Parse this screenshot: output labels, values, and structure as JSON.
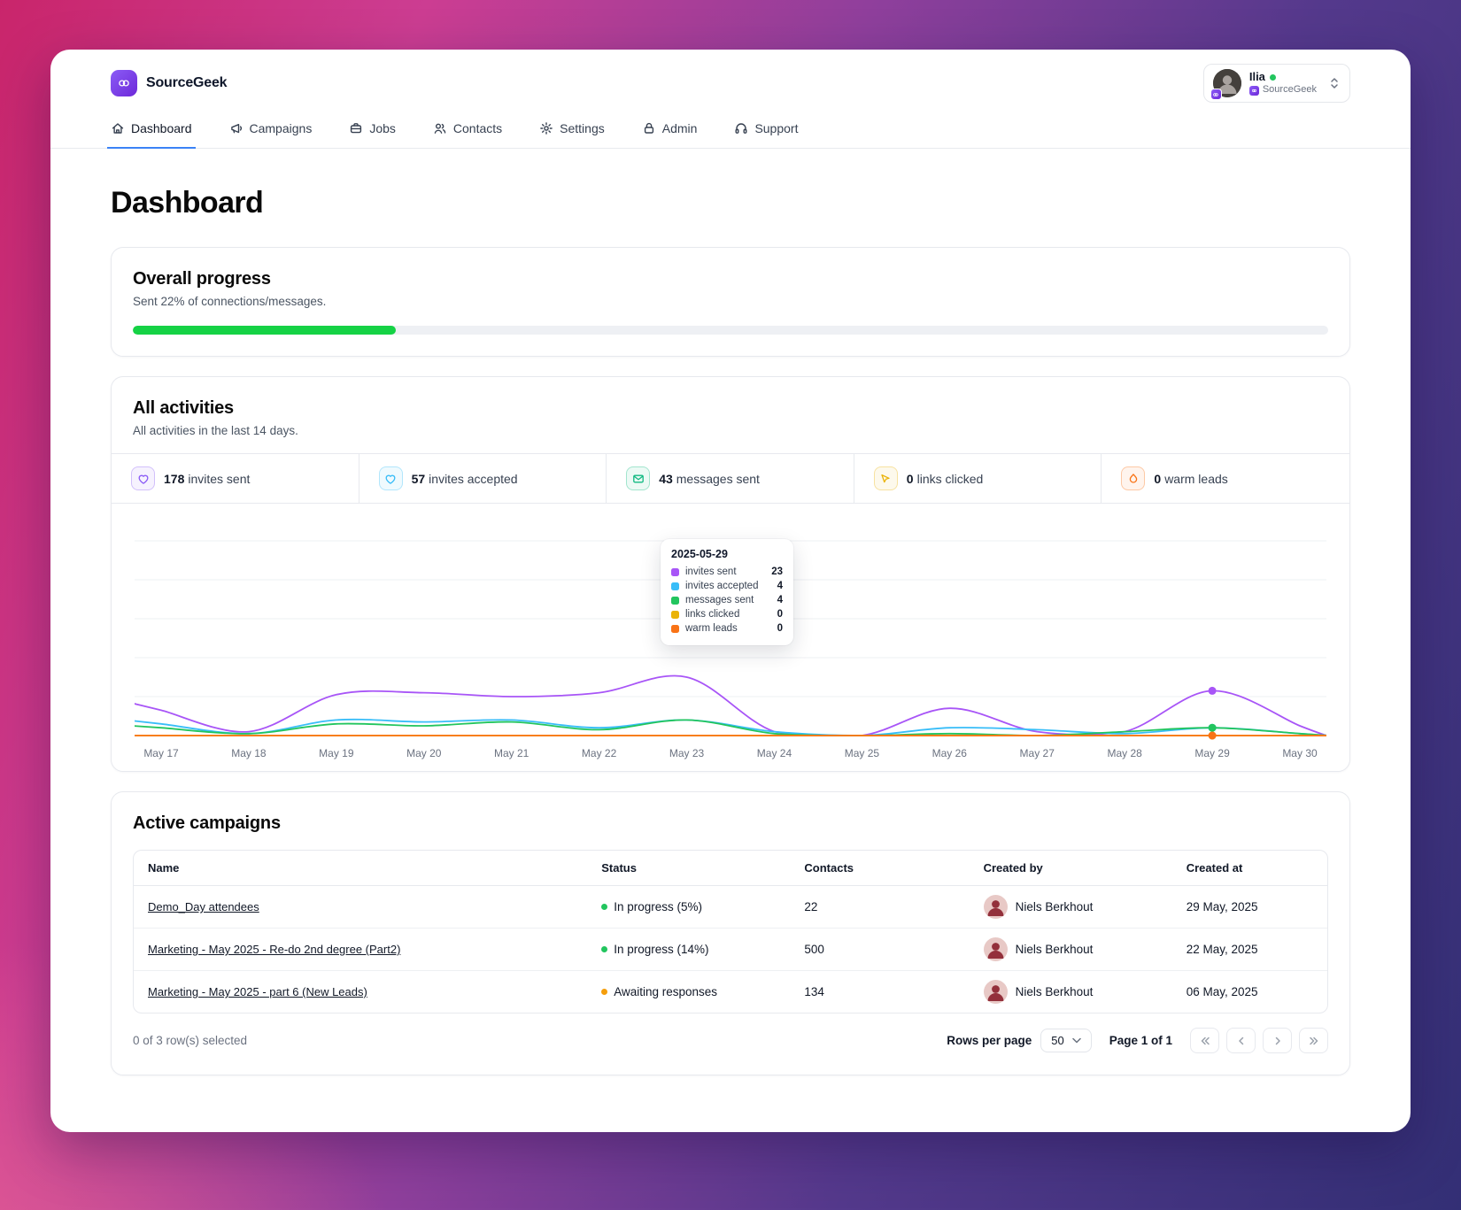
{
  "app": {
    "name": "SourceGeek"
  },
  "user": {
    "name": "Ilia",
    "org": "SourceGeek"
  },
  "nav": [
    {
      "label": "Dashboard",
      "icon": "home",
      "active": true
    },
    {
      "label": "Campaigns",
      "icon": "megaphone",
      "active": false
    },
    {
      "label": "Jobs",
      "icon": "briefcase",
      "active": false
    },
    {
      "label": "Contacts",
      "icon": "users",
      "active": false
    },
    {
      "label": "Settings",
      "icon": "gear",
      "active": false
    },
    {
      "label": "Admin",
      "icon": "lock",
      "active": false
    },
    {
      "label": "Support",
      "icon": "headset",
      "active": false
    }
  ],
  "page_title": "Dashboard",
  "overall_progress": {
    "title": "Overall progress",
    "subtitle": "Sent 22% of connections/messages.",
    "percent": 22,
    "bar_color": "#15d245"
  },
  "activities": {
    "title": "All activities",
    "subtitle": "All activities in the last 14 days.",
    "stats": [
      {
        "value": "178",
        "label": "invites sent",
        "icon": "heart",
        "color": "#8b5cf6"
      },
      {
        "value": "57",
        "label": "invites accepted",
        "icon": "heart",
        "color": "#38bdf8"
      },
      {
        "value": "43",
        "label": "messages sent",
        "icon": "mail",
        "color": "#10b981"
      },
      {
        "value": "0",
        "label": "links clicked",
        "icon": "cursor",
        "color": "#eab308"
      },
      {
        "value": "0",
        "label": "warm leads",
        "icon": "flame",
        "color": "#f97316"
      }
    ]
  },
  "chart_data": {
    "type": "line",
    "x": [
      "May 17",
      "May 18",
      "May 19",
      "May 20",
      "May 21",
      "May 22",
      "May 23",
      "May 24",
      "May 25",
      "May 26",
      "May 27",
      "May 28",
      "May 29",
      "May 30"
    ],
    "series": [
      {
        "name": "invites sent",
        "color": "#a855f7",
        "values": [
          13,
          2,
          21,
          22,
          20,
          22,
          30,
          2,
          0,
          14,
          2,
          2,
          23,
          5
        ]
      },
      {
        "name": "invites accepted",
        "color": "#38bdf8",
        "values": [
          6,
          1,
          8,
          7,
          8,
          4,
          8,
          2,
          0,
          4,
          3,
          1,
          4,
          1
        ]
      },
      {
        "name": "messages sent",
        "color": "#22c55e",
        "values": [
          4,
          1,
          6,
          5,
          7,
          3,
          8,
          1,
          0,
          1,
          0,
          2,
          4,
          1
        ]
      },
      {
        "name": "links clicked",
        "color": "#eab308",
        "values": [
          0,
          0,
          0,
          0,
          0,
          0,
          0,
          0,
          0,
          0,
          0,
          0,
          0,
          0
        ]
      },
      {
        "name": "warm leads",
        "color": "#f97316",
        "values": [
          0,
          0,
          0,
          0,
          0,
          0,
          0,
          0,
          0,
          0,
          0,
          0,
          0,
          0
        ]
      }
    ],
    "ylim": [
      0,
      100
    ],
    "grid": true,
    "legend_position": "tooltip",
    "highlight_x": "May 29",
    "tooltip": {
      "title": "2025-05-29",
      "rows": [
        {
          "label": "invites sent",
          "value": 23,
          "color": "#a855f7"
        },
        {
          "label": "invites accepted",
          "value": 4,
          "color": "#38bdf8"
        },
        {
          "label": "messages sent",
          "value": 4,
          "color": "#22c55e"
        },
        {
          "label": "links clicked",
          "value": 0,
          "color": "#eab308"
        },
        {
          "label": "warm leads",
          "value": 0,
          "color": "#f97316"
        }
      ]
    }
  },
  "campaigns": {
    "title": "Active campaigns",
    "columns": [
      "Name",
      "Status",
      "Contacts",
      "Created by",
      "Created at"
    ],
    "rows": [
      {
        "name": "Demo_Day attendees",
        "status": "In progress (5%)",
        "status_color": "#22c55e",
        "contacts": "22",
        "created_by": "Niels Berkhout",
        "created_at": "29 May, 2025"
      },
      {
        "name": "Marketing - May 2025 - Re-do 2nd degree (Part2)",
        "status": "In progress (14%)",
        "status_color": "#22c55e",
        "contacts": "500",
        "created_by": "Niels Berkhout",
        "created_at": "22 May, 2025"
      },
      {
        "name": "Marketing - May 2025 - part 6 (New Leads)",
        "status": "Awaiting responses",
        "status_color": "#f59e0b",
        "contacts": "134",
        "created_by": "Niels Berkhout",
        "created_at": "06 May, 2025"
      }
    ],
    "footer": {
      "selected": "0 of 3 row(s) selected",
      "rows_per_page_label": "Rows per page",
      "rows_per_page": "50",
      "page_info": "Page 1 of 1"
    }
  }
}
